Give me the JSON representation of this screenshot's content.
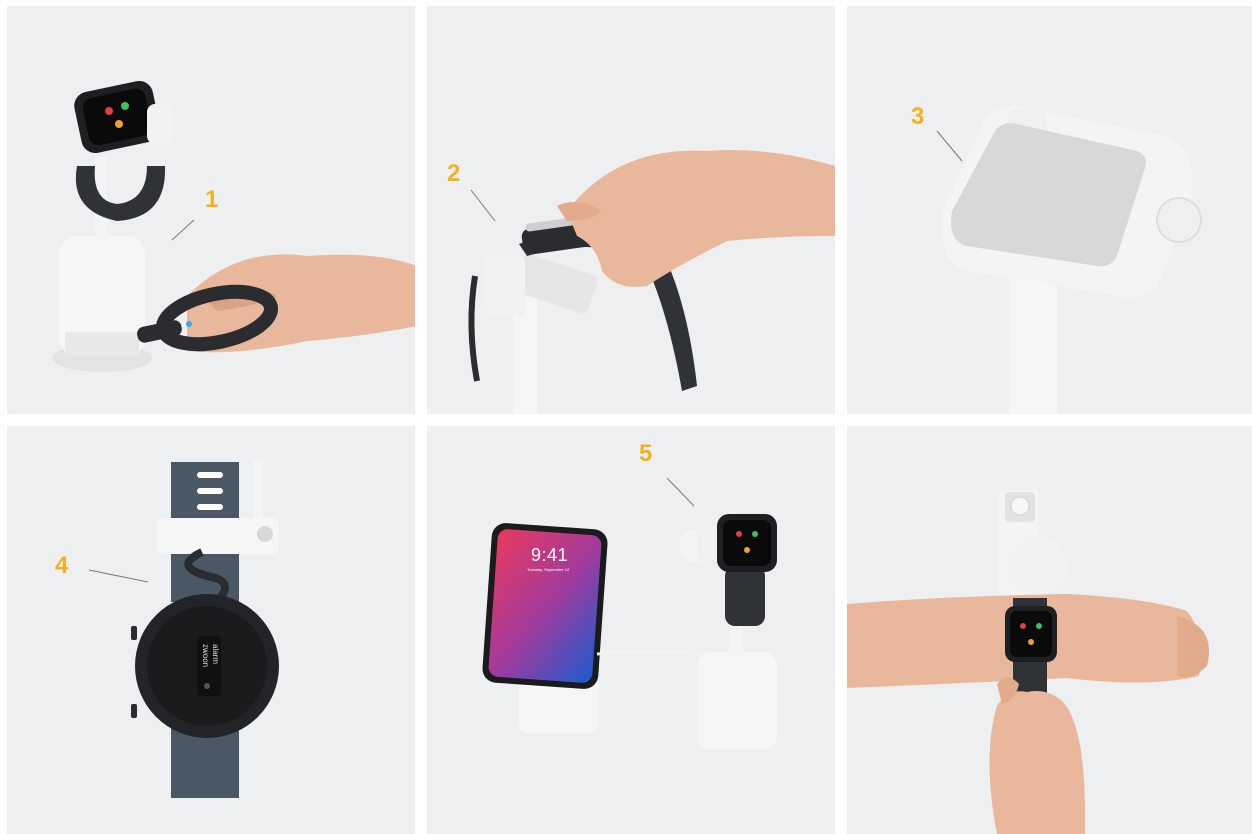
{
  "panels": [
    {
      "callout": "1"
    },
    {
      "callout": "2"
    },
    {
      "callout": "3"
    },
    {
      "callout": "4",
      "strap_text_1": "zwoon",
      "strap_text_2": "alarm"
    },
    {
      "callout": "5",
      "phone_time": "9:41",
      "phone_date": "Tuesday, September 12"
    },
    {
      "callout": ""
    }
  ],
  "colors": {
    "callout": "#f2b21b",
    "panel_bg": "#eeeff0",
    "device_white": "#f4f4f4",
    "band_dark": "#2f3338",
    "band_slate": "#4a5866"
  }
}
